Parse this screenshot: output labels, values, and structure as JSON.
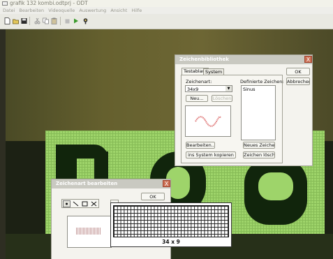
{
  "window": {
    "title": "grafik  132  kombi.odtprj - ODT"
  },
  "menu": [
    "Datei",
    "Bearbeiten",
    "Videoquelle",
    "Auswertung",
    "Ansicht",
    "Hilfe"
  ],
  "toolbar_icons": [
    "new-file-icon",
    "open-folder-icon",
    "save-icon",
    "cut-icon",
    "copy-icon",
    "paste-icon",
    "stop-icon",
    "play-icon",
    "help-icon"
  ],
  "library_dialog": {
    "title": "Zeichenbibliothek",
    "tabs": [
      "Testablauf",
      "System"
    ],
    "charset_label": "Zeichenart:",
    "charset_value": "34x9",
    "new_label": "Neu...",
    "delete_label": "Löschen",
    "edit_label": "Bearbeiten...",
    "copy_label": "ins System kopieren",
    "defined_label": "Definierte Zeichen:",
    "defined_items": [
      "Sinus"
    ],
    "new_char_label": "Neues Zeichen",
    "delete_char_label": "Zeichen löschen",
    "ok_label": "OK",
    "cancel_label": "Abbrechen",
    "close_label": "X"
  },
  "edit_dialog": {
    "title": "Zeichenart bearbeiten",
    "ok_label": "OK",
    "close_label": "X",
    "tools": [
      "point-tool-icon",
      "line-tool-icon",
      "rect-tool-icon",
      "move-tool-icon"
    ],
    "dropdown_icon": "chevron-down-icon"
  },
  "grid_popup": {
    "caption": "34 x 9"
  },
  "colors": {
    "close_button": "#cb6e52",
    "display_green": "#9ed46a",
    "display_dark": "#11250c",
    "sine_wave": "#e07a7a"
  }
}
